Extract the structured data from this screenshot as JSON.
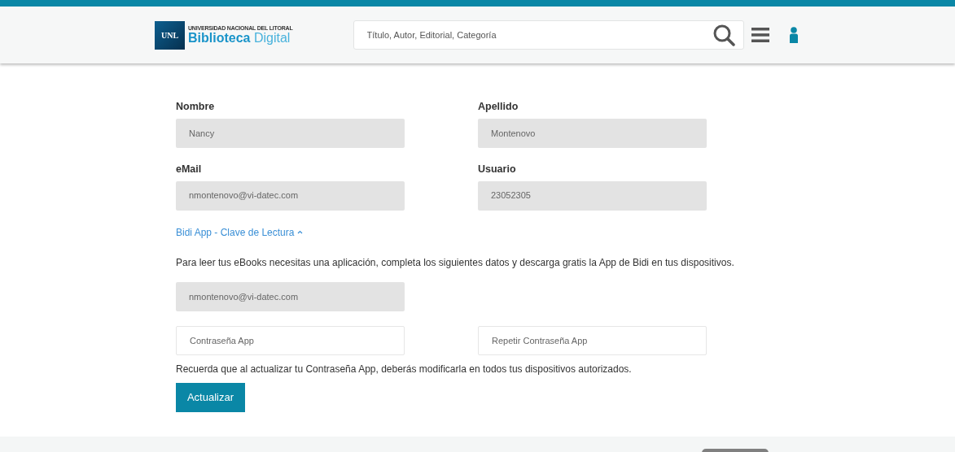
{
  "header": {
    "logo": {
      "badge": "UNL",
      "org": "UNIVERSIDAD NACIONAL DEL LITORAL",
      "title_bold": "Biblioteca",
      "title_light": "Digital"
    },
    "search": {
      "placeholder": "Título, Autor, Editorial, Categoría"
    }
  },
  "personal_fields": [
    {
      "label": "Nombre",
      "value": "Nancy"
    },
    {
      "label": "Apellido",
      "value": "Montenovo"
    },
    {
      "label": "eMail",
      "value": "nmontenovo@vi-datec.com"
    },
    {
      "label": "Usuario",
      "value": "23052305"
    }
  ],
  "app_section": {
    "toggle": "Bidi App - Clave de Lectura",
    "expanded": true,
    "intro": "Para leer tus eBooks necesitas una aplicación, completa los siguientes datos y descarga gratis la App de Bidi en tus dispositivos.",
    "email": "nmontenovo@vi-datec.com",
    "password_fields": [
      {
        "placeholder": "Contraseña App"
      },
      {
        "placeholder": "Repetir Contraseña App"
      }
    ],
    "note": "Recuerda que al actualizar tu Contraseña App, deberás modificarla en todos tus dispositivos autorizados.",
    "button": "Actualizar"
  }
}
